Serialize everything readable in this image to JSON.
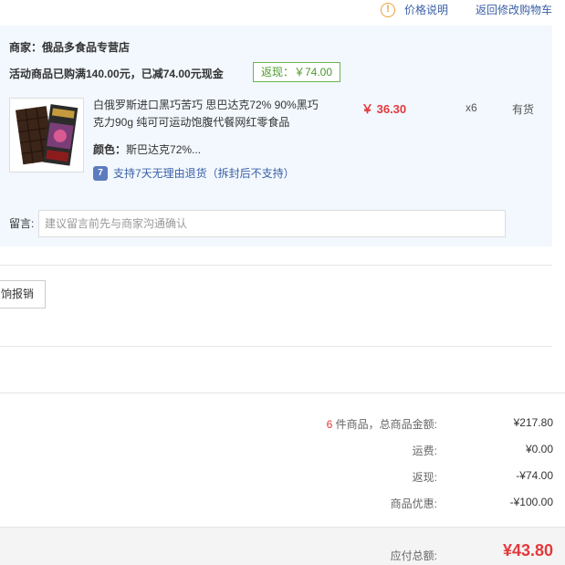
{
  "header": {
    "price_help": "价格说明",
    "back_to_cart": "返回修改购物车"
  },
  "shop": {
    "merchant_label": "商家：",
    "merchant_name": "俄品多食品专营店",
    "promo_text": "活动商品已购满140.00元，已减74.00元现金",
    "rebate": "返现：￥74.00"
  },
  "item": {
    "title": "白俄罗斯进口黑巧苦巧 思巴达克72% 90%黑巧克力90g 纯可可运动饱腹代餐网红零食品",
    "price": "￥ 36.30",
    "quantity": "x6",
    "stock": "有货",
    "color_label": "颜色：",
    "color_value": "斯巴达克72%...",
    "return_icon": "7",
    "return_policy": "支持7天无理由退货（拆封后不支持）"
  },
  "message": {
    "label": "留言:",
    "placeholder": "建议留言前先与商家沟通确认"
  },
  "invoice": {
    "button_label": "饷报销"
  },
  "summary": {
    "count": "6",
    "count_suffix": " 件商品，总商品金额:",
    "subtotal": "¥217.80",
    "shipping_label": "运费:",
    "shipping": "¥0.00",
    "rebate_label": "返现:",
    "rebate": "-¥74.00",
    "discount_label": "商品优惠:",
    "discount": "-¥100.00",
    "total_label": "应付总额:",
    "total": "¥43.80"
  },
  "colors": {
    "accent_red": "#e4393c",
    "link_blue": "#3a5fa8",
    "panel_bg": "#f2f8fd",
    "rebate_green": "#4b9a2b"
  }
}
